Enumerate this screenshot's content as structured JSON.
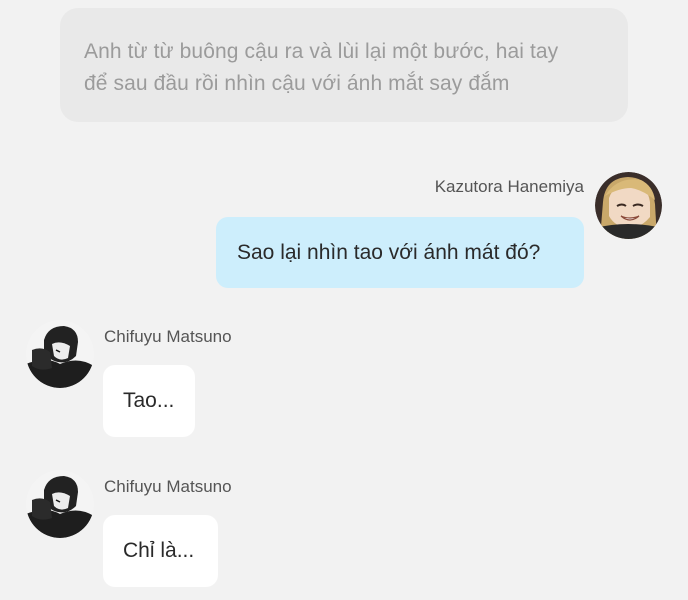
{
  "narration": {
    "line1": "Anh từ từ buông cậu ra và lùi lại một bước, hai tay",
    "line2": "để sau đầu rồi nhìn cậu với ánh mắt say đắm"
  },
  "messages": [
    {
      "sender": "Kazutora Hanemiya",
      "text": "Sao lại nhìn tao với ánh mát đó?",
      "side": "right",
      "avatar_icon": "kazutora-avatar-icon"
    },
    {
      "sender": "Chifuyu Matsuno",
      "text": "Tao...",
      "side": "left",
      "avatar_icon": "chifuyu-avatar-icon"
    },
    {
      "sender": "Chifuyu Matsuno",
      "text": "Chỉ là...",
      "side": "left",
      "avatar_icon": "chifuyu-avatar-icon"
    }
  ],
  "colors": {
    "background": "#f2f2f2",
    "narration_bg": "#e9e9e9",
    "self_bubble": "#cdeefc",
    "other_bubble": "#ffffff"
  }
}
